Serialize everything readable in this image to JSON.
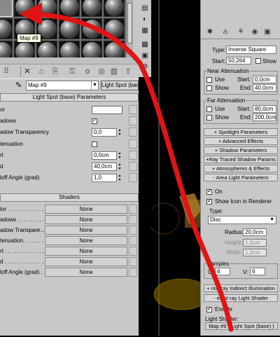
{
  "material_editor": {
    "tooltip": "Map #9",
    "map_name": "Map #9",
    "map_type": "Light Spot (base)",
    "rollup_params": "Light Spot (base) Parameters",
    "params": [
      {
        "label": "or",
        "kind": "swatch"
      },
      {
        "label": "adows",
        "kind": "check",
        "checked": "✓"
      },
      {
        "label": "adow Transparency",
        "kind": "field",
        "value": "0,0"
      },
      {
        "label": "tenuation",
        "kind": "check",
        "checked": ""
      },
      {
        "label": "rt",
        "kind": "field",
        "value": "0,0cm"
      },
      {
        "label": "d",
        "kind": "field",
        "value": "40,0cm"
      },
      {
        "label": "loff Angle (grad)",
        "kind": "field",
        "value": "1,0"
      }
    ],
    "rollup_shaders": "Shaders",
    "shaders": [
      {
        "label": "lor . . . . . . . . . . . . . .",
        "value": "None"
      },
      {
        "label": "adows . . . . . . . . . . . .",
        "value": "None"
      },
      {
        "label": "adow Transpare...",
        "value": "None"
      },
      {
        "label": "tenuation. . . . . . . . . . .",
        "value": "None"
      },
      {
        "label": "rt . . . . . . . . . . . . . . . .",
        "value": "None"
      },
      {
        "label": "d . . . . . . . . . . . . . . . . .",
        "value": "None"
      },
      {
        "label": "loff Angle (grad) . . . . .",
        "value": "None"
      }
    ]
  },
  "command_panel": {
    "type_label": "Type:",
    "type_value": "Inverse Square",
    "start_label": "Start:",
    "start_value": "50,264",
    "show_label": "Show",
    "near_title": "Near Attenuation",
    "near_use": "Use",
    "near_show": "Show",
    "near_start_label": "Start:",
    "near_start": "0,0cm",
    "near_end_label": "End:",
    "near_end": "40,0cm",
    "far_title": "Far Attenuation",
    "far_use": "Use",
    "far_show": "Show",
    "far_start_label": "Start:",
    "far_start": "80,0cm",
    "far_end_label": "End:",
    "far_end": "200,0cm",
    "rollups": [
      "+    Spotlight Parameters",
      "+      Advanced Effects",
      "+     Shadow Parameters",
      "+Ray Traced Shadow Params",
      "+   Atmospheres & Effects",
      "-    Area Light Parameters"
    ],
    "on_label": "On",
    "show_icon_label": "Show Icon in Renderer",
    "type2_label": "Type:",
    "type2_value": "Disc",
    "radius_label": "Radius:",
    "radius_value": "20,0cm",
    "height_label": "Height:",
    "height_value": "1,0cm",
    "width_label": "Width:",
    "width_value": "1,0cm",
    "samples_title": "Samples",
    "u_label": "U:",
    "u_value": "6",
    "v_label": "V:",
    "v_value": "6",
    "mr_indirect": "+ ntal ray Indirect Illumination",
    "mr_shader": "-   ental ray Light Shader",
    "enable_label": "Enable",
    "light_shader_label": "Light Shader:",
    "light_shader_value": "Map #9 ( Light Spot (base) )"
  },
  "colors": {
    "accent_arrow": "#e01414",
    "panel": "#c8c8c8"
  }
}
